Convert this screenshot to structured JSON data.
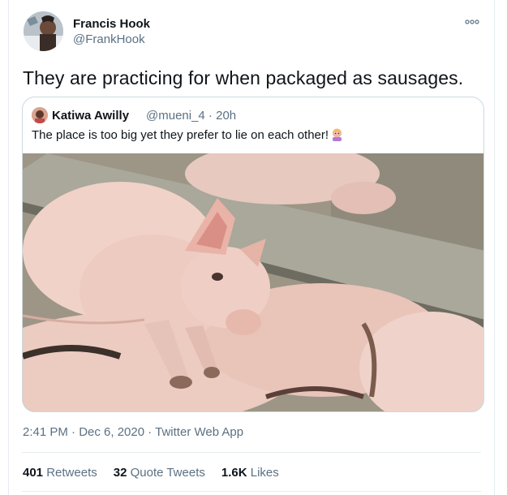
{
  "author": {
    "name": "Francis Hook",
    "handle": "@FrankHook"
  },
  "tweet": {
    "text": "They are practicing for when packaged as sausages."
  },
  "quoted": {
    "name": "Katiwa Awilly",
    "meta": "@mueni_4 · 20h",
    "text": "The place is too big yet they prefer to lie on each other!",
    "emoji": "person-raising-hand-icon",
    "image_alt": "Piglets lying on top of each other in a concrete pen"
  },
  "timestamp": "2:41 PM · Dec 6, 2020 · Twitter Web App",
  "stats": {
    "retweets_count": "401",
    "retweets_label": "Retweets",
    "quotes_count": "32",
    "quotes_label": "Quote Tweets",
    "likes_count": "1.6K",
    "likes_label": "Likes"
  },
  "colors": {
    "text": "#0f1419",
    "secondary": "#5b7083",
    "border": "#cfd9de"
  }
}
